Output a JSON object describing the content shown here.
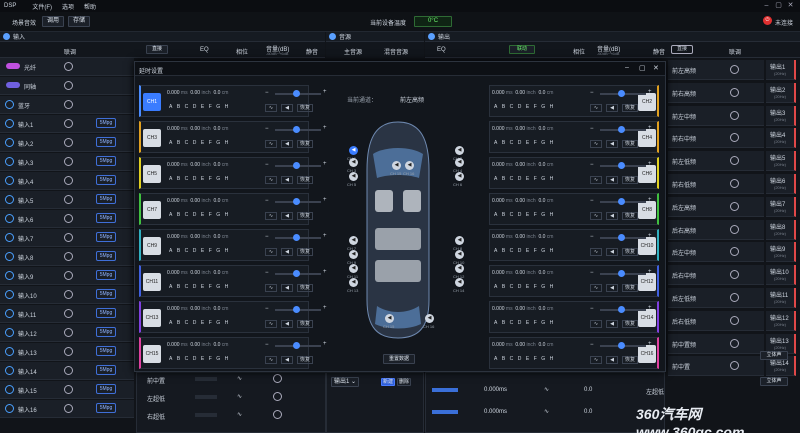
{
  "titlebar": {
    "app": "DSP",
    "menus": [
      "文件(F)",
      "选项",
      "帮助"
    ]
  },
  "toolbar": {
    "preset_label": "场景音效",
    "call_label": "调用",
    "save_label": "存储",
    "temp_label": "当前设备温度",
    "temp_value": "0°C",
    "status_label": "未连接"
  },
  "input": {
    "title": "输入",
    "col_link": "联调",
    "route_label": "直接",
    "col_eq": "EQ",
    "col_phase": "相位",
    "col_vol": "音量(dB)",
    "col_range": "-60dB~+6dB",
    "col_mute": "静音",
    "rows": [
      {
        "label": "光纤",
        "badge": ""
      },
      {
        "label": "同轴",
        "badge": ""
      },
      {
        "label": "蓝牙",
        "badge": ""
      },
      {
        "label": "输入1",
        "badge": "5Mpg"
      },
      {
        "label": "输入2",
        "badge": "5Mpg"
      },
      {
        "label": "输入3",
        "badge": "5Mpg"
      },
      {
        "label": "输入4",
        "badge": "5Mpg"
      },
      {
        "label": "输入5",
        "badge": "5Mpg"
      },
      {
        "label": "输入6",
        "badge": "5Mpg"
      },
      {
        "label": "输入7",
        "badge": "5Mpg"
      },
      {
        "label": "输入8",
        "badge": "5Mpg"
      },
      {
        "label": "输入9",
        "badge": "5Mpg"
      },
      {
        "label": "输入10",
        "badge": "5Mpg"
      },
      {
        "label": "输入11",
        "badge": "5Mpg"
      },
      {
        "label": "输入12",
        "badge": "5Mpg"
      },
      {
        "label": "输入13",
        "badge": "5Mpg"
      },
      {
        "label": "输入14",
        "badge": "5Mpg"
      },
      {
        "label": "输入15",
        "badge": "5Mpg"
      },
      {
        "label": "输入16",
        "badge": "5Mpg"
      }
    ]
  },
  "mixer": {
    "title": "音源",
    "main_label": "主音源",
    "alt_label": "混音音源"
  },
  "output": {
    "title": "输出",
    "col_link": "联调",
    "route_label": "联动",
    "col_eq": "EQ",
    "col_phase": "相位",
    "col_vol": "音量(dB)",
    "col_range": "-60dB~+6dB",
    "col_mute": "静音",
    "rows": [
      {
        "label": "前左高频",
        "out": "输出1",
        "sub": "(20Hz)"
      },
      {
        "label": "前右高频",
        "out": "输出2",
        "sub": "(20Hz)"
      },
      {
        "label": "前左中频",
        "out": "输出3",
        "sub": "(20Hz)"
      },
      {
        "label": "前右中频",
        "out": "输出4",
        "sub": "(20Hz)"
      },
      {
        "label": "前左低频",
        "out": "输出5",
        "sub": "(20Hz)"
      },
      {
        "label": "前右低频",
        "out": "输出6",
        "sub": "(20Hz)"
      },
      {
        "label": "后左高频",
        "out": "输出7",
        "sub": "(20Hz)"
      },
      {
        "label": "后右高频",
        "out": "输出8",
        "sub": "(20Hz)"
      },
      {
        "label": "后左中频",
        "out": "输出9",
        "sub": "(20Hz)"
      },
      {
        "label": "后右中频",
        "out": "输出10",
        "sub": "(20Hz)"
      },
      {
        "label": "后左低频",
        "out": "输出11",
        "sub": "(20Hz)"
      },
      {
        "label": "后右低频",
        "out": "输出12",
        "sub": "(20Hz)"
      },
      {
        "label": "前中置频",
        "out": "输出13",
        "sub": "(20Hz)"
      },
      {
        "label": "前中置",
        "out": "输出14",
        "sub": "(20Hz)"
      }
    ],
    "stereo_label": "立体声"
  },
  "modal": {
    "title": "延时设置",
    "current_label": "当前通道：",
    "current_value": "前左高频",
    "reset_label": "重置数据",
    "delay_ms": "0.000",
    "unit_ms": "ms",
    "delay_inch": "0.00",
    "unit_inch": "inch",
    "delay_cm": "0.0",
    "unit_cm": "cm",
    "letters": "ABCDEFGH",
    "restore_label": "恢复",
    "left_channels": [
      {
        "name": "CH1",
        "color": "#4a8cff",
        "active": true
      },
      {
        "name": "CH3",
        "color": "#e0a020"
      },
      {
        "name": "CH5",
        "color": "#e0d020"
      },
      {
        "name": "CH7",
        "color": "#40c040"
      },
      {
        "name": "CH9",
        "color": "#30b0c0"
      },
      {
        "name": "CH11",
        "color": "#4060e0"
      },
      {
        "name": "CH13",
        "color": "#8040e0"
      },
      {
        "name": "CH15",
        "color": "#e040a0"
      }
    ],
    "right_channels": [
      {
        "name": "CH2",
        "color": "#e0a020"
      },
      {
        "name": "CH4",
        "color": "#e0a020"
      },
      {
        "name": "CH6",
        "color": "#e0d020"
      },
      {
        "name": "CH8",
        "color": "#40c040"
      },
      {
        "name": "CH10",
        "color": "#30b0c0"
      },
      {
        "name": "CH12",
        "color": "#4060e0"
      },
      {
        "name": "CH14",
        "color": "#8040e0"
      },
      {
        "name": "CH16",
        "color": "#e040a0"
      }
    ],
    "speaker_labels": [
      "CH 15",
      "CH 16",
      "CH 1",
      "CH 2",
      "CH 3",
      "CH 4",
      "CH 5",
      "CH 6",
      "CH 7",
      "CH 8",
      "CH 9",
      "CH 10",
      "CH 11",
      "CH 12",
      "CH 13",
      "CH 14",
      "CH 15",
      "CH 16"
    ]
  },
  "bottom": {
    "mid_label": "前中置",
    "mid2_label": "右超低",
    "left_low": "左超低",
    "out_select": "输出1",
    "btn_a": "新建",
    "btn_b": "删除",
    "ms_value": "0.000ms",
    "val1": "0.0",
    "val2": "左超低",
    "left_low2": "右超低"
  },
  "watermark": "360汽车网 www.360qc.com"
}
